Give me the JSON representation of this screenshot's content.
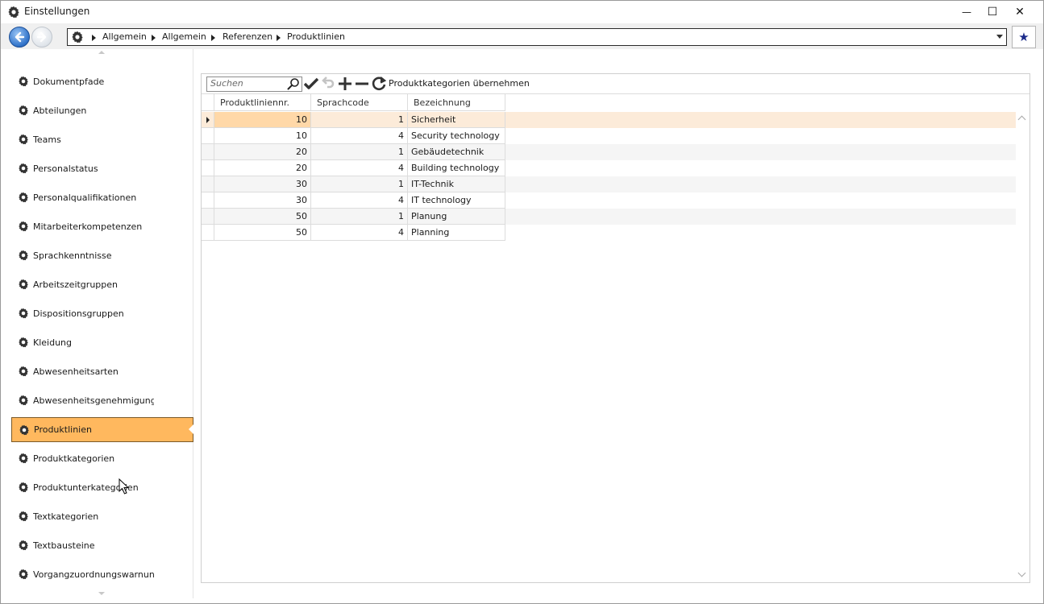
{
  "window": {
    "title": "Einstellungen",
    "minimize": "—",
    "maximize": "☐",
    "close": "✕"
  },
  "address_bar": {
    "crumbs": [
      "Allgemein",
      "Allgemein",
      "Referenzen",
      "Produktlinien"
    ],
    "favorite_icon": "★"
  },
  "sidebar": {
    "items": [
      {
        "label": "Dokumentpfade"
      },
      {
        "label": "Abteilungen"
      },
      {
        "label": "Teams"
      },
      {
        "label": "Personalstatus"
      },
      {
        "label": "Personalqualifikationen"
      },
      {
        "label": "Mitarbeiterkompetenzen"
      },
      {
        "label": "Sprachkenntnisse"
      },
      {
        "label": "Arbeitszeitgruppen"
      },
      {
        "label": "Dispositionsgruppen"
      },
      {
        "label": "Kleidung"
      },
      {
        "label": "Abwesenheitsarten"
      },
      {
        "label": "Abwesenheitsgenehmigungsgr"
      },
      {
        "label": "Produktlinien"
      },
      {
        "label": "Produktkategorien"
      },
      {
        "label": "Produktunterkategorien"
      },
      {
        "label": "Textkategorien"
      },
      {
        "label": "Textbausteine"
      },
      {
        "label": "Vorgangzuordnungswarnunger"
      }
    ],
    "active_index": 12,
    "accent_color": "#ffb85e"
  },
  "toolbar": {
    "search_placeholder": "Suchen",
    "apply_label": "Produktkategorien übernehmen"
  },
  "table": {
    "columns": [
      "Produktliniennr.",
      "Sprachcode",
      "Bezeichnung"
    ],
    "rows": [
      {
        "nr": "10",
        "code": "1",
        "name": "Sicherheit"
      },
      {
        "nr": "10",
        "code": "4",
        "name": "Security technology"
      },
      {
        "nr": "20",
        "code": "1",
        "name": "Gebäudetechnik"
      },
      {
        "nr": "20",
        "code": "4",
        "name": "Building technology"
      },
      {
        "nr": "30",
        "code": "1",
        "name": "IT-Technik"
      },
      {
        "nr": "30",
        "code": "4",
        "name": "IT technology"
      },
      {
        "nr": "50",
        "code": "1",
        "name": "Planung"
      },
      {
        "nr": "50",
        "code": "4",
        "name": "Planning"
      }
    ],
    "current_row": 0
  }
}
